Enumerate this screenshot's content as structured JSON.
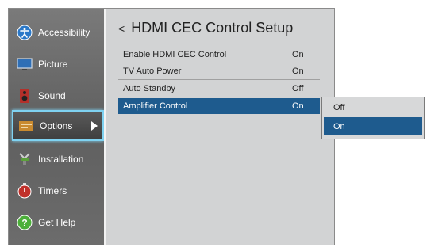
{
  "sidebar": {
    "items": [
      {
        "label": "Accessibility",
        "icon": "accessibility-icon"
      },
      {
        "label": "Picture",
        "icon": "picture-icon"
      },
      {
        "label": "Sound",
        "icon": "sound-icon"
      },
      {
        "label": "Options",
        "icon": "options-icon",
        "selected": true
      },
      {
        "label": "Installation",
        "icon": "installation-icon"
      },
      {
        "label": "Timers",
        "icon": "timers-icon"
      },
      {
        "label": "Get Help",
        "icon": "help-icon"
      }
    ]
  },
  "main": {
    "back_glyph": "<",
    "title": "HDMI CEC Control Setup",
    "rows": [
      {
        "label": "Enable HDMI CEC Control",
        "value": "On"
      },
      {
        "label": "TV Auto Power",
        "value": "On"
      },
      {
        "label": "Auto Standby",
        "value": "Off"
      },
      {
        "label": "Amplifier Control",
        "value": "On",
        "active": true
      }
    ]
  },
  "dropdown": {
    "options": [
      {
        "label": "Off"
      },
      {
        "label": "On",
        "selected": true
      }
    ]
  },
  "colors": {
    "highlight": "#1e5b8e",
    "focus_border": "#7fd2f1",
    "panel_bg": "#d2d3d4"
  }
}
